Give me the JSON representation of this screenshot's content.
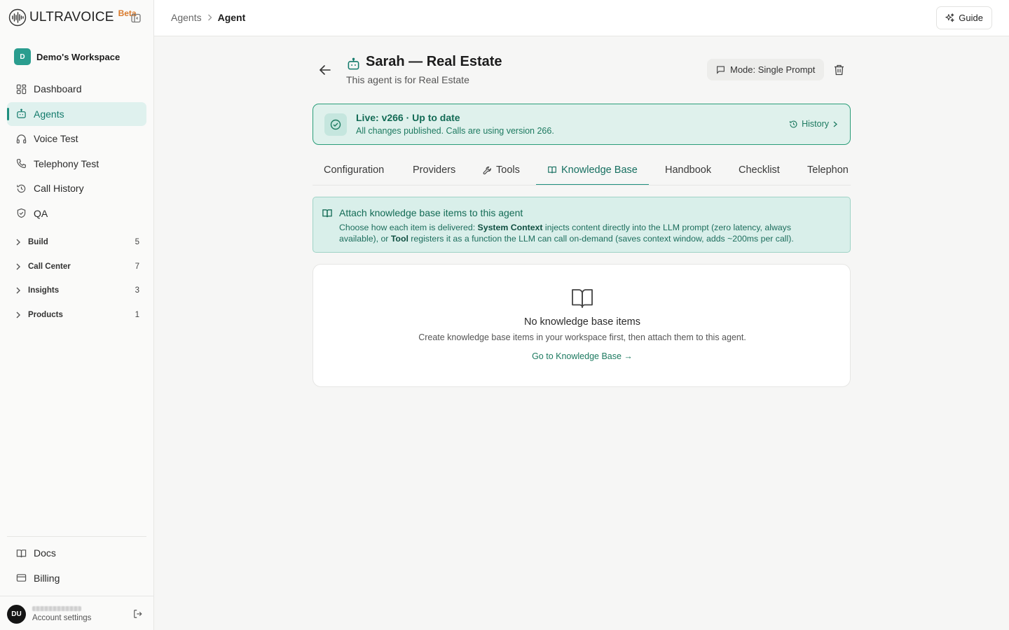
{
  "brand": {
    "name": "ULTRAVOICE",
    "badge": "Beta"
  },
  "workspace": {
    "initial": "D",
    "name": "Demo's Workspace"
  },
  "nav": {
    "dashboard": "Dashboard",
    "agents": "Agents",
    "voice_test": "Voice Test",
    "telephony_test": "Telephony Test",
    "call_history": "Call History",
    "qa": "QA"
  },
  "groups": [
    {
      "label": "Build",
      "count": "5"
    },
    {
      "label": "Call Center",
      "count": "7"
    },
    {
      "label": "Insights",
      "count": "3"
    },
    {
      "label": "Products",
      "count": "1"
    }
  ],
  "bottom_nav": {
    "docs": "Docs",
    "billing": "Billing"
  },
  "user": {
    "initials": "DU",
    "subtitle": "Account settings"
  },
  "breadcrumb": {
    "parent": "Agents",
    "current": "Agent"
  },
  "topbar": {
    "guide_label": "Guide"
  },
  "agent": {
    "title": "Sarah — Real Estate",
    "subtitle": "This agent is for Real Estate",
    "mode_label": "Mode: Single Prompt"
  },
  "live": {
    "title": "Live: v266 · Up to date",
    "description": "All changes published. Calls are using version 266.",
    "history_label": "History"
  },
  "tabs": {
    "configuration": "Configuration",
    "providers": "Providers",
    "tools": "Tools",
    "knowledge_base": "Knowledge Base",
    "handbook": "Handbook",
    "checklist": "Checklist",
    "telephony": "Telephon"
  },
  "info": {
    "title": "Attach knowledge base items to this agent",
    "text_1": "Choose how each item is delivered: ",
    "bold_1": "System Context",
    "text_2": " injects content directly into the LLM prompt (zero latency, always available), or ",
    "bold_2": "Tool",
    "text_3": " registers it as a function the LLM can call on-demand (saves context window, adds ~200ms per call)."
  },
  "empty": {
    "title": "No knowledge base items",
    "description": "Create knowledge base items in your workspace first, then attach them to this agent.",
    "link": "Go to Knowledge Base →"
  },
  "colors": {
    "accent": "#1f8f7f",
    "accent_text": "#136b55",
    "live_bg": "#dff1ec",
    "info_bg": "#d9efea",
    "brand_beta": "#d97a2b"
  }
}
